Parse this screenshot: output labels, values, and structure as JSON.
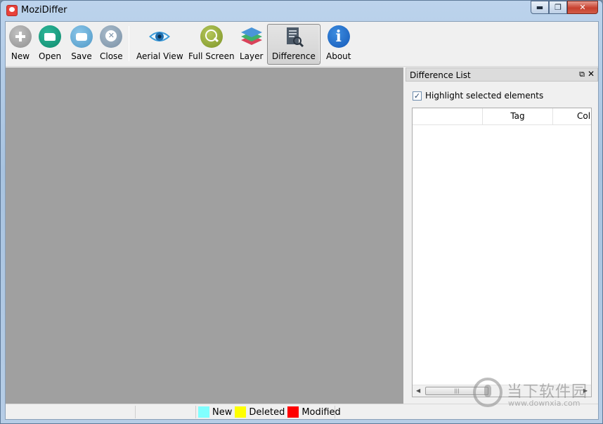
{
  "window": {
    "title": "MoziDiffer"
  },
  "toolbar": {
    "items": [
      {
        "label": "New",
        "icon": "plus-circle-icon"
      },
      {
        "label": "Open",
        "icon": "folder-open-icon"
      },
      {
        "label": "Save",
        "icon": "briefcase-save-icon"
      },
      {
        "label": "Close",
        "icon": "close-circle-icon"
      },
      {
        "label": "Aerial View",
        "icon": "eye-icon"
      },
      {
        "label": "Full Screen",
        "icon": "zoom-in-icon"
      },
      {
        "label": "Layer",
        "icon": "layers-icon"
      },
      {
        "label": "Difference",
        "icon": "document-search-icon",
        "active": true
      },
      {
        "label": "About",
        "icon": "info-icon"
      }
    ]
  },
  "panel": {
    "title": "Difference List",
    "highlight_label": "Highlight selected elements",
    "highlight_checked": true,
    "columns": [
      "",
      "Tag",
      "Col"
    ]
  },
  "status": {
    "legend": [
      {
        "label": "New",
        "color": "#80ffff"
      },
      {
        "label": "Deleted",
        "color": "#ffff00"
      },
      {
        "label": "Modified",
        "color": "#ff0000"
      }
    ]
  },
  "watermark": {
    "text": "当下软件园",
    "url": "www.downxia.com"
  },
  "colors": {
    "canvas": "#a0a0a0",
    "active_button": "#d6d6d6"
  }
}
